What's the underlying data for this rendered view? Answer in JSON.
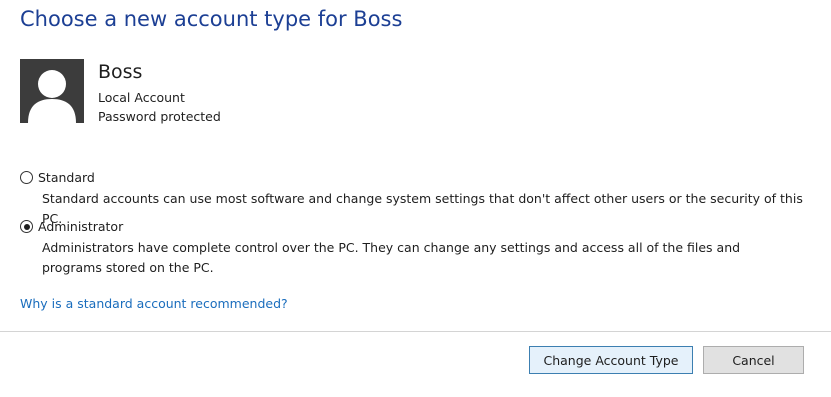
{
  "dialog": {
    "title": "Choose a new account type for Boss"
  },
  "user": {
    "name": "Boss",
    "account_kind": "Local Account",
    "security": "Password protected",
    "avatar_icon": "user-silhouette-icon"
  },
  "options": {
    "standard": {
      "label": "Standard",
      "description": "Standard accounts can use most software and change system settings that don't affect other users or the security of this PC.",
      "selected": false
    },
    "administrator": {
      "label": "Administrator",
      "description": "Administrators have complete control over the PC. They can change any settings and access all of the files and programs stored on the PC.",
      "selected": true
    }
  },
  "help_link": "Why is a standard account recommended?",
  "buttons": {
    "change": "Change Account Type",
    "cancel": "Cancel"
  },
  "colors": {
    "title": "#1c3f94",
    "link": "#1a6dbd",
    "avatar_bg": "#3c3c3c",
    "primary_button_border": "#3c7fb1"
  }
}
